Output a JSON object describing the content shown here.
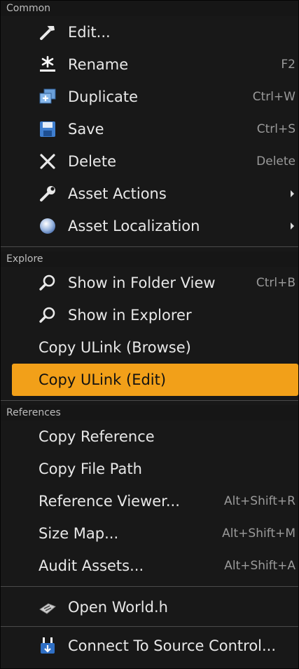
{
  "sections": [
    {
      "header": "Common",
      "items": [
        {
          "label": "Edit...",
          "shortcut": "",
          "icon": "hammer-icon",
          "submenu": false
        },
        {
          "label": "Rename",
          "shortcut": "F2",
          "icon": "rename-star-icon",
          "submenu": false
        },
        {
          "label": "Duplicate",
          "shortcut": "Ctrl+W",
          "icon": "duplicate-icon",
          "submenu": false
        },
        {
          "label": "Save",
          "shortcut": "Ctrl+S",
          "icon": "save-disk-icon",
          "submenu": false
        },
        {
          "label": "Delete",
          "shortcut": "Delete",
          "icon": "delete-x-icon",
          "submenu": false
        },
        {
          "label": "Asset Actions",
          "shortcut": "",
          "icon": "wrench-icon",
          "submenu": true
        },
        {
          "label": "Asset Localization",
          "shortcut": "",
          "icon": "globe-icon",
          "submenu": true
        }
      ]
    },
    {
      "header": "Explore",
      "items": [
        {
          "label": "Show in Folder View",
          "shortcut": "Ctrl+B",
          "icon": "magnifier-icon"
        },
        {
          "label": "Show in Explorer",
          "shortcut": "",
          "icon": "magnifier-icon"
        },
        {
          "label": "Copy ULink (Browse)",
          "shortcut": "",
          "icon": ""
        },
        {
          "label": "Copy ULink (Edit)",
          "shortcut": "",
          "icon": "",
          "highlighted": true
        }
      ]
    },
    {
      "header": "References",
      "items": [
        {
          "label": "Copy Reference",
          "shortcut": ""
        },
        {
          "label": "Copy File Path",
          "shortcut": ""
        },
        {
          "label": "Reference Viewer...",
          "shortcut": "Alt+Shift+R"
        },
        {
          "label": "Size Map...",
          "shortcut": "Alt+Shift+M"
        },
        {
          "label": "Audit Assets...",
          "shortcut": "Alt+Shift+A"
        }
      ]
    }
  ],
  "extra_items": [
    {
      "label": "Open World.h",
      "icon": "cpp-file-icon"
    },
    {
      "label": "Connect To Source Control...",
      "icon": "source-control-icon"
    }
  ],
  "colors": {
    "background": "#181818",
    "highlight": "#f2a019",
    "text": "#e8e8e8",
    "shortcut_text": "#9a9a9a",
    "header_text": "#bdbdbd"
  }
}
